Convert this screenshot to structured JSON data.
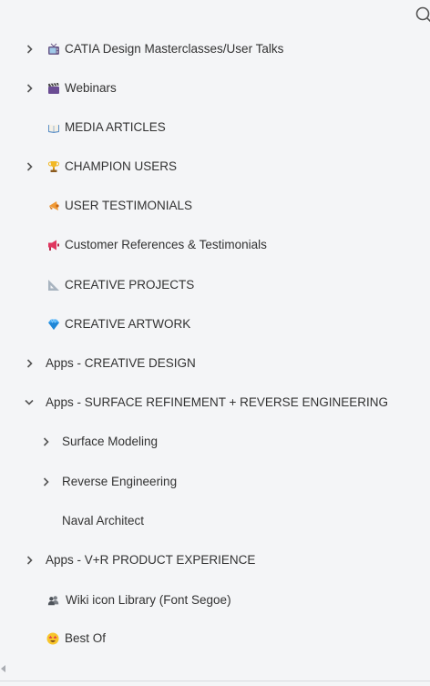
{
  "nav": {
    "items": [
      {
        "label": "CATIA Design Masterclasses/User Talks",
        "expandable": true,
        "expanded": false,
        "icon": "tv-icon",
        "level": 0
      },
      {
        "label": "Webinars",
        "expandable": true,
        "expanded": false,
        "icon": "clapper-board-icon",
        "level": 0
      },
      {
        "label": "MEDIA ARTICLES",
        "expandable": false,
        "icon": "open-book-icon",
        "level": 0
      },
      {
        "label": "CHAMPION USERS",
        "expandable": true,
        "expanded": false,
        "icon": "trophy-icon",
        "level": 0
      },
      {
        "label": "USER TESTIMONIALS",
        "expandable": false,
        "icon": "megaphone-icon",
        "level": 0
      },
      {
        "label": "Customer References & Testimonials",
        "expandable": false,
        "icon": "loudspeaker-icon",
        "level": 0
      },
      {
        "label": "CREATIVE PROJECTS",
        "expandable": false,
        "icon": "triangular-ruler-icon",
        "level": 0
      },
      {
        "label": "CREATIVE ARTWORK",
        "expandable": false,
        "icon": "gem-icon",
        "level": 0
      },
      {
        "label": "Apps - CREATIVE DESIGN",
        "expandable": true,
        "expanded": false,
        "level": 0
      },
      {
        "label": "Apps - SURFACE REFINEMENT + REVERSE ENGINEERING",
        "expandable": true,
        "expanded": true,
        "level": 0
      },
      {
        "label": "Surface Modeling",
        "expandable": true,
        "expanded": false,
        "level": 1
      },
      {
        "label": "Reverse Engineering",
        "expandable": true,
        "expanded": false,
        "level": 1
      },
      {
        "label": "Naval Architect",
        "expandable": false,
        "level": 1
      },
      {
        "label": "Apps - V+R PRODUCT EXPERIENCE",
        "expandable": true,
        "expanded": false,
        "level": 0
      },
      {
        "label": "Wiki icon Library (Font Segoe)",
        "expandable": false,
        "icon": "people-icon",
        "level": 0
      },
      {
        "label": "Best Of",
        "expandable": false,
        "icon": "star-struck-face-icon",
        "level": 0
      }
    ]
  },
  "colors": {
    "background": "#f4f5f7",
    "text": "#323232",
    "chevron": "#555555"
  }
}
